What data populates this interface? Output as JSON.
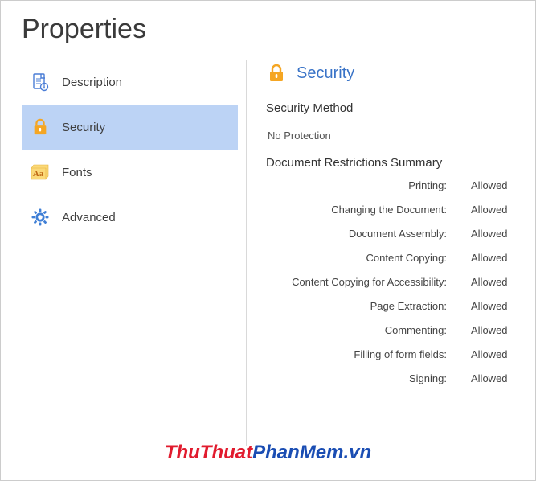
{
  "page_title": "Properties",
  "sidebar": {
    "items": [
      {
        "label": "Description",
        "icon": "file-info",
        "selected": false
      },
      {
        "label": "Security",
        "icon": "lock",
        "selected": true
      },
      {
        "label": "Fonts",
        "icon": "fonts",
        "selected": false
      },
      {
        "label": "Advanced",
        "icon": "gear",
        "selected": false
      }
    ]
  },
  "main": {
    "section_title": "Security",
    "security_method_label": "Security Method",
    "security_method_value": "No Protection",
    "summary_heading": "Document Restrictions Summary",
    "restrictions": [
      {
        "label": "Printing:",
        "value": "Allowed"
      },
      {
        "label": "Changing the Document:",
        "value": "Allowed"
      },
      {
        "label": "Document Assembly:",
        "value": "Allowed"
      },
      {
        "label": "Content Copying:",
        "value": "Allowed"
      },
      {
        "label": "Content Copying for Accessibility:",
        "value": "Allowed"
      },
      {
        "label": "Page Extraction:",
        "value": "Allowed"
      },
      {
        "label": "Commenting:",
        "value": "Allowed"
      },
      {
        "label": "Filling of form fields:",
        "value": "Allowed"
      },
      {
        "label": "Signing:",
        "value": "Allowed"
      }
    ]
  },
  "watermark": {
    "part1": "ThuThuat",
    "part2": "PhanMem.vn"
  }
}
